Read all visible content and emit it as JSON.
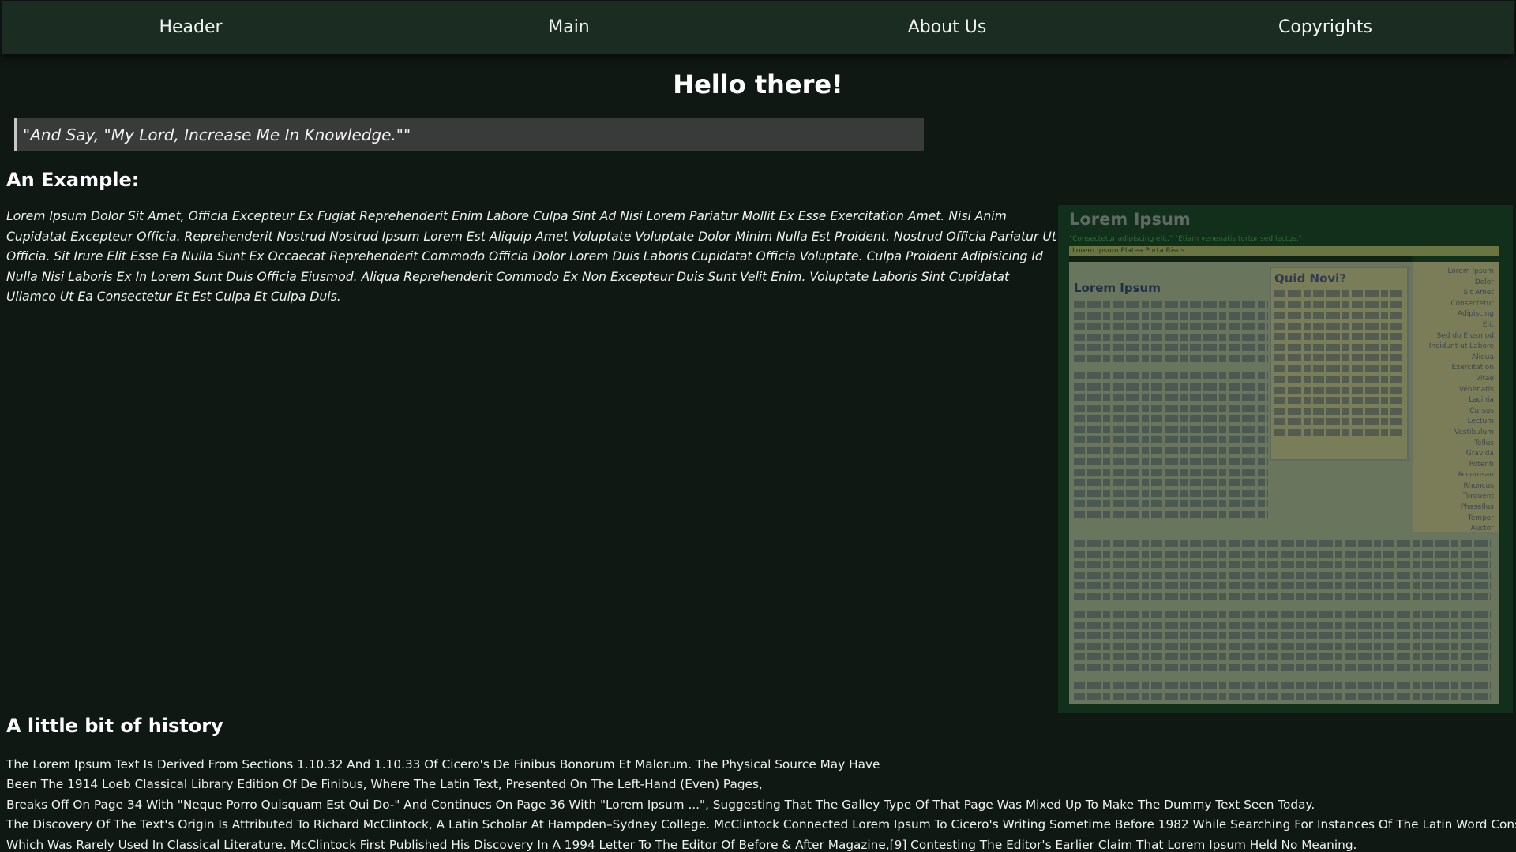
{
  "nav": {
    "items": [
      {
        "label": "Header"
      },
      {
        "label": "Main"
      },
      {
        "label": "About Us"
      },
      {
        "label": "Copyrights"
      }
    ]
  },
  "page": {
    "title": "Hello there!",
    "quote": "\"And Say, \"My Lord, Increase Me In Knowledge.\"\""
  },
  "example": {
    "heading": "An Example:",
    "paragraph": "Lorem Ipsum Dolor Sit Amet, Officia Excepteur Ex Fugiat Reprehenderit Enim Labore Culpa Sint Ad Nisi Lorem Pariatur Mollit Ex Esse Exercitation Amet. Nisi Anim Cupidatat Excepteur Officia. Reprehenderit Nostrud Nostrud Ipsum Lorem Est Aliquip Amet Voluptate Voluptate Dolor Minim Nulla Est Proident. Nostrud Officia Pariatur Ut Officia. Sit Irure Elit Esse Ea Nulla Sunt Ex Occaecat Reprehenderit Commodo Officia Dolor Lorem Duis Laboris Cupidatat Officia Voluptate. Culpa Proident Adipisicing Id Nulla Nisi Laboris Ex In Lorem Sunt Duis Officia Eiusmod. Aliqua Reprehenderit Commodo Ex Non Excepteur Duis Sunt Velit Enim. Voluptate Laboris Sint Cupidatat Ullamco Ut Ea Consectetur Et Est Culpa Et Culpa Duis.",
    "image": {
      "title": "Lorem Ipsum",
      "tagline": "\"Consectetur adipiscing elit.\" \"Etiam venenatis tortor sed lectus.\"",
      "menubar": "Lorem Ipsum   Platea   Porta   Risus",
      "heading_left": "Lorem Ipsum",
      "heading_box": "Quid Novi?",
      "sidenav": [
        "Lorem Ipsum",
        "Dolor",
        "Sit Amet",
        "Consectetur",
        "Adipiscing",
        "Elit",
        "Sed do Eiusmod",
        "Incidunt ut Labore",
        "Aliqua",
        "Exercitation",
        "Vitae",
        "Venenatis",
        "Lacinia",
        "Cursus",
        "Lectum",
        "Vestibulum",
        "Tellus",
        "Gravida",
        "Potenti",
        "Accumsan",
        "Rhoncus",
        "Torquent",
        "Phasellus",
        "Tempor",
        "Auctor"
      ]
    }
  },
  "history": {
    "heading": "A little bit of history",
    "lines": [
      "The Lorem Ipsum Text Is Derived From Sections 1.10.32 And 1.10.33 Of Cicero's De Finibus Bonorum Et Malorum. The Physical Source May Have",
      "Been The 1914 Loeb Classical Library Edition Of De Finibus, Where The Latin Text, Presented On The Left-Hand (Even) Pages,",
      "Breaks Off On Page 34 With \"Neque Porro Quisquam Est Qui Do-\" And Continues On Page 36 With \"Lorem Ipsum ...\", Suggesting That The Galley Type Of That Page Was Mixed Up To Make The Dummy Text Seen Today.",
      "The Discovery Of The Text's Origin Is Attributed To Richard McClintock, A Latin Scholar At Hampden–Sydney College. McClintock Connected Lorem Ipsum To Cicero's Writing Sometime Before 1982 While Searching For Instances Of The Latin Word Consectetur,",
      "Which Was Rarely Used In Classical Literature. McClintock First Published His Discovery In A 1994 Letter To The Editor Of Before & After Magazine,[9] Contesting The Editor's Earlier Claim That Lorem Ipsum Held No Meaning."
    ]
  }
}
